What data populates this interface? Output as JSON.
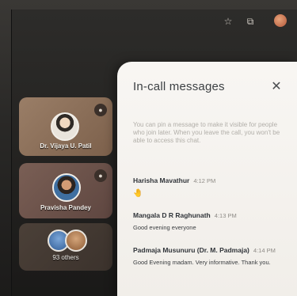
{
  "toolbar": {
    "icons": [
      "star-icon",
      "extension-icon",
      "profile-avatar"
    ]
  },
  "participants": [
    {
      "name": "Dr. Vijaya U. Patil"
    },
    {
      "name": "Pravisha Pandey"
    },
    {
      "name": "93 others"
    }
  ],
  "panel": {
    "title": "In-call messages",
    "info": "You can pin a message to make it visible for people who join later. When you leave the call, you won't be able to access this chat.",
    "messages": [
      {
        "sender": "Harisha Mavathur",
        "time": "4:12 PM",
        "text": "🤚"
      },
      {
        "sender": "Mangala D R Raghunath",
        "time": "4:13 PM",
        "text": "Good evening everyone"
      },
      {
        "sender": "Padmaja Musunuru (Dr. M. Padmaja)",
        "time": "4:14 PM",
        "text": "Good Evening madam. Very informative. Thank you."
      }
    ]
  }
}
